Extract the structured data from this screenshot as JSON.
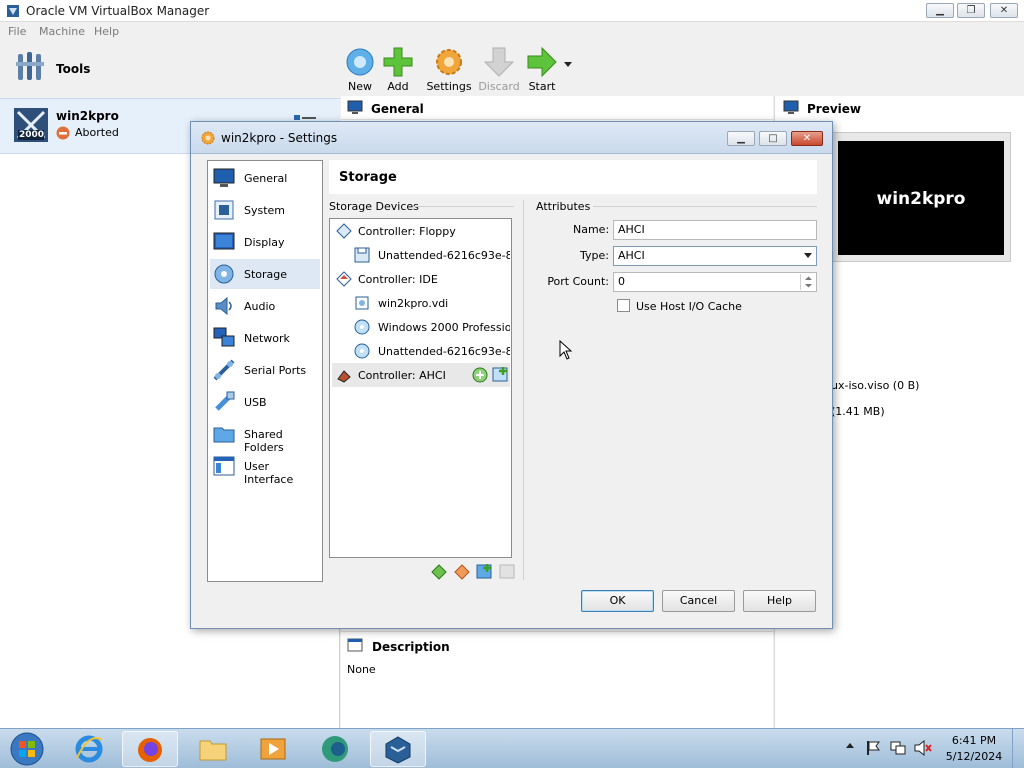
{
  "app": {
    "title": "Oracle VM VirtualBox Manager"
  },
  "menu": [
    "File",
    "Machine",
    "Help"
  ],
  "tools": {
    "label": "Tools"
  },
  "vm": {
    "name": "win2kpro",
    "state": "Aborted",
    "os_badge": "2000"
  },
  "toolbar": {
    "new": "New",
    "add": "Add",
    "settings": "Settings",
    "discard": "Discard",
    "start": "Start"
  },
  "details": {
    "general_heading": "General",
    "preview_heading": "Preview",
    "preview_text": "win2kpro",
    "partial_line_1": "ux-iso.viso (0 B)",
    "partial_line_2": "(1.41 MB)",
    "description_heading": "Description",
    "description_value": "None"
  },
  "dialog": {
    "title": "win2kpro - Settings",
    "categories": [
      "General",
      "System",
      "Display",
      "Storage",
      "Audio",
      "Network",
      "Serial Ports",
      "USB",
      "Shared Folders",
      "User Interface"
    ],
    "selected_category": "Storage",
    "page_title": "Storage",
    "storage_devices_label": "Storage Devices",
    "attributes_label": "Attributes",
    "tree": [
      {
        "label": "Controller: Floppy",
        "kind": "controller-floppy"
      },
      {
        "label": "Unattended-6216c93e-8...",
        "kind": "floppy-disk"
      },
      {
        "label": "Controller: IDE",
        "kind": "controller-ide"
      },
      {
        "label": "win2kpro.vdi",
        "kind": "hard-disk"
      },
      {
        "label": "Windows 2000 Professio...",
        "kind": "optical-disk"
      },
      {
        "label": "Unattended-6216c93e-8...",
        "kind": "optical-disk"
      },
      {
        "label": "Controller: AHCI",
        "kind": "controller-ahci"
      }
    ],
    "name_label": "Name:",
    "name_value": "AHCI",
    "type_label": "Type:",
    "type_value": "AHCI",
    "port_count_label": "Port Count:",
    "port_count_value": "0",
    "host_cache_label": "Use Host I/O Cache",
    "host_cache_checked": false,
    "ok_label": "OK",
    "cancel_label": "Cancel",
    "help_label": "Help"
  },
  "taskbar": {
    "apps": [
      "start-orb",
      "internet-explorer",
      "firefox",
      "file-explorer",
      "media-player",
      "app-icon",
      "virtualbox"
    ],
    "time": "6:41 PM",
    "date": "5/12/2024"
  },
  "colors": {
    "accent": "#3c7fb1",
    "selection": "#dde8f4",
    "taskbar": "#b4cde4"
  }
}
